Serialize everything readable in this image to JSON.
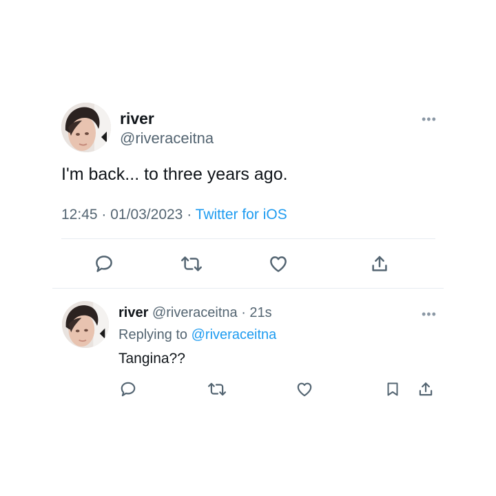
{
  "main_tweet": {
    "display_name": "river",
    "handle": "@riveraceitna",
    "text": "I'm back... to three years ago.",
    "time": "12:45",
    "date": "01/03/2023",
    "separator": "·",
    "source": "Twitter for iOS",
    "more_icon": "more-horizontal-icon",
    "actions": [
      "reply-icon",
      "retweet-icon",
      "like-icon",
      "share-icon"
    ]
  },
  "reply_tweet": {
    "display_name": "river",
    "handle": "@riveraceitna",
    "separator": "·",
    "age": "21s",
    "replying_prefix": "Replying to",
    "replying_handle": "@riveraceitna",
    "text": "Tangina??",
    "more_icon": "more-horizontal-icon",
    "actions": [
      "reply-icon",
      "retweet-icon",
      "like-icon",
      "bookmark-icon",
      "share-icon"
    ]
  },
  "colors": {
    "text": "#0f1419",
    "muted": "#536471",
    "link": "#1d9bf0",
    "divider": "#e6ecf0",
    "icon": "#536471"
  }
}
